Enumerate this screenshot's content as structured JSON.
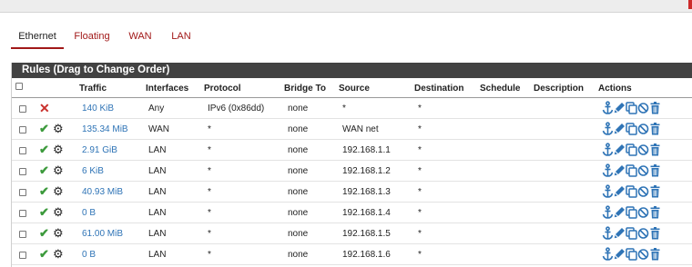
{
  "tabs": [
    {
      "label": "Ethernet",
      "active": true
    },
    {
      "label": "Floating",
      "active": false
    },
    {
      "label": "WAN",
      "active": false
    },
    {
      "label": "LAN",
      "active": false
    }
  ],
  "panel": {
    "title": "Rules (Drag to Change Order)"
  },
  "table": {
    "headers": {
      "traffic": "Traffic",
      "interfaces": "Interfaces",
      "protocol": "Protocol",
      "bridge_to": "Bridge To",
      "source": "Source",
      "destination": "Destination",
      "schedule": "Schedule",
      "description": "Description",
      "actions": "Actions"
    },
    "rows": [
      {
        "status": "block",
        "traffic": "140 KiB",
        "interfaces": "Any",
        "protocol": "IPv6 (0x86dd)",
        "bridge_to": "none",
        "source": "*",
        "destination": "*",
        "schedule": "",
        "description": ""
      },
      {
        "status": "pass",
        "traffic": "135.34 MiB",
        "interfaces": "WAN",
        "protocol": "*",
        "bridge_to": "none",
        "source": "WAN net",
        "destination": "*",
        "schedule": "",
        "description": ""
      },
      {
        "status": "pass",
        "traffic": "2.91 GiB",
        "interfaces": "LAN",
        "protocol": "*",
        "bridge_to": "none",
        "source": "192.168.1.1",
        "destination": "*",
        "schedule": "",
        "description": ""
      },
      {
        "status": "pass",
        "traffic": "6 KiB",
        "interfaces": "LAN",
        "protocol": "*",
        "bridge_to": "none",
        "source": "192.168.1.2",
        "destination": "*",
        "schedule": "",
        "description": ""
      },
      {
        "status": "pass",
        "traffic": "40.93 MiB",
        "interfaces": "LAN",
        "protocol": "*",
        "bridge_to": "none",
        "source": "192.168.1.3",
        "destination": "*",
        "schedule": "",
        "description": ""
      },
      {
        "status": "pass",
        "traffic": "0 B",
        "interfaces": "LAN",
        "protocol": "*",
        "bridge_to": "none",
        "source": "192.168.1.4",
        "destination": "*",
        "schedule": "",
        "description": ""
      },
      {
        "status": "pass",
        "traffic": "61.00 MiB",
        "interfaces": "LAN",
        "protocol": "*",
        "bridge_to": "none",
        "source": "192.168.1.5",
        "destination": "*",
        "schedule": "",
        "description": ""
      },
      {
        "status": "pass",
        "traffic": "0 B",
        "interfaces": "LAN",
        "protocol": "*",
        "bridge_to": "none",
        "source": "192.168.1.6",
        "destination": "*",
        "schedule": "",
        "description": ""
      }
    ]
  },
  "icons": {
    "block": "x-icon",
    "pass": "checkmark-icon",
    "advanced": "gear-icon",
    "actions": [
      "anchor-icon",
      "pencil-icon",
      "copy-icon",
      "disable-icon",
      "trash-icon"
    ]
  },
  "colors": {
    "accent": "#a11818",
    "link": "#2f74b6",
    "action_icon": "#2f74b6",
    "pass": "#3c9a3c",
    "block": "#c9302c",
    "panel_header": "#424242"
  }
}
